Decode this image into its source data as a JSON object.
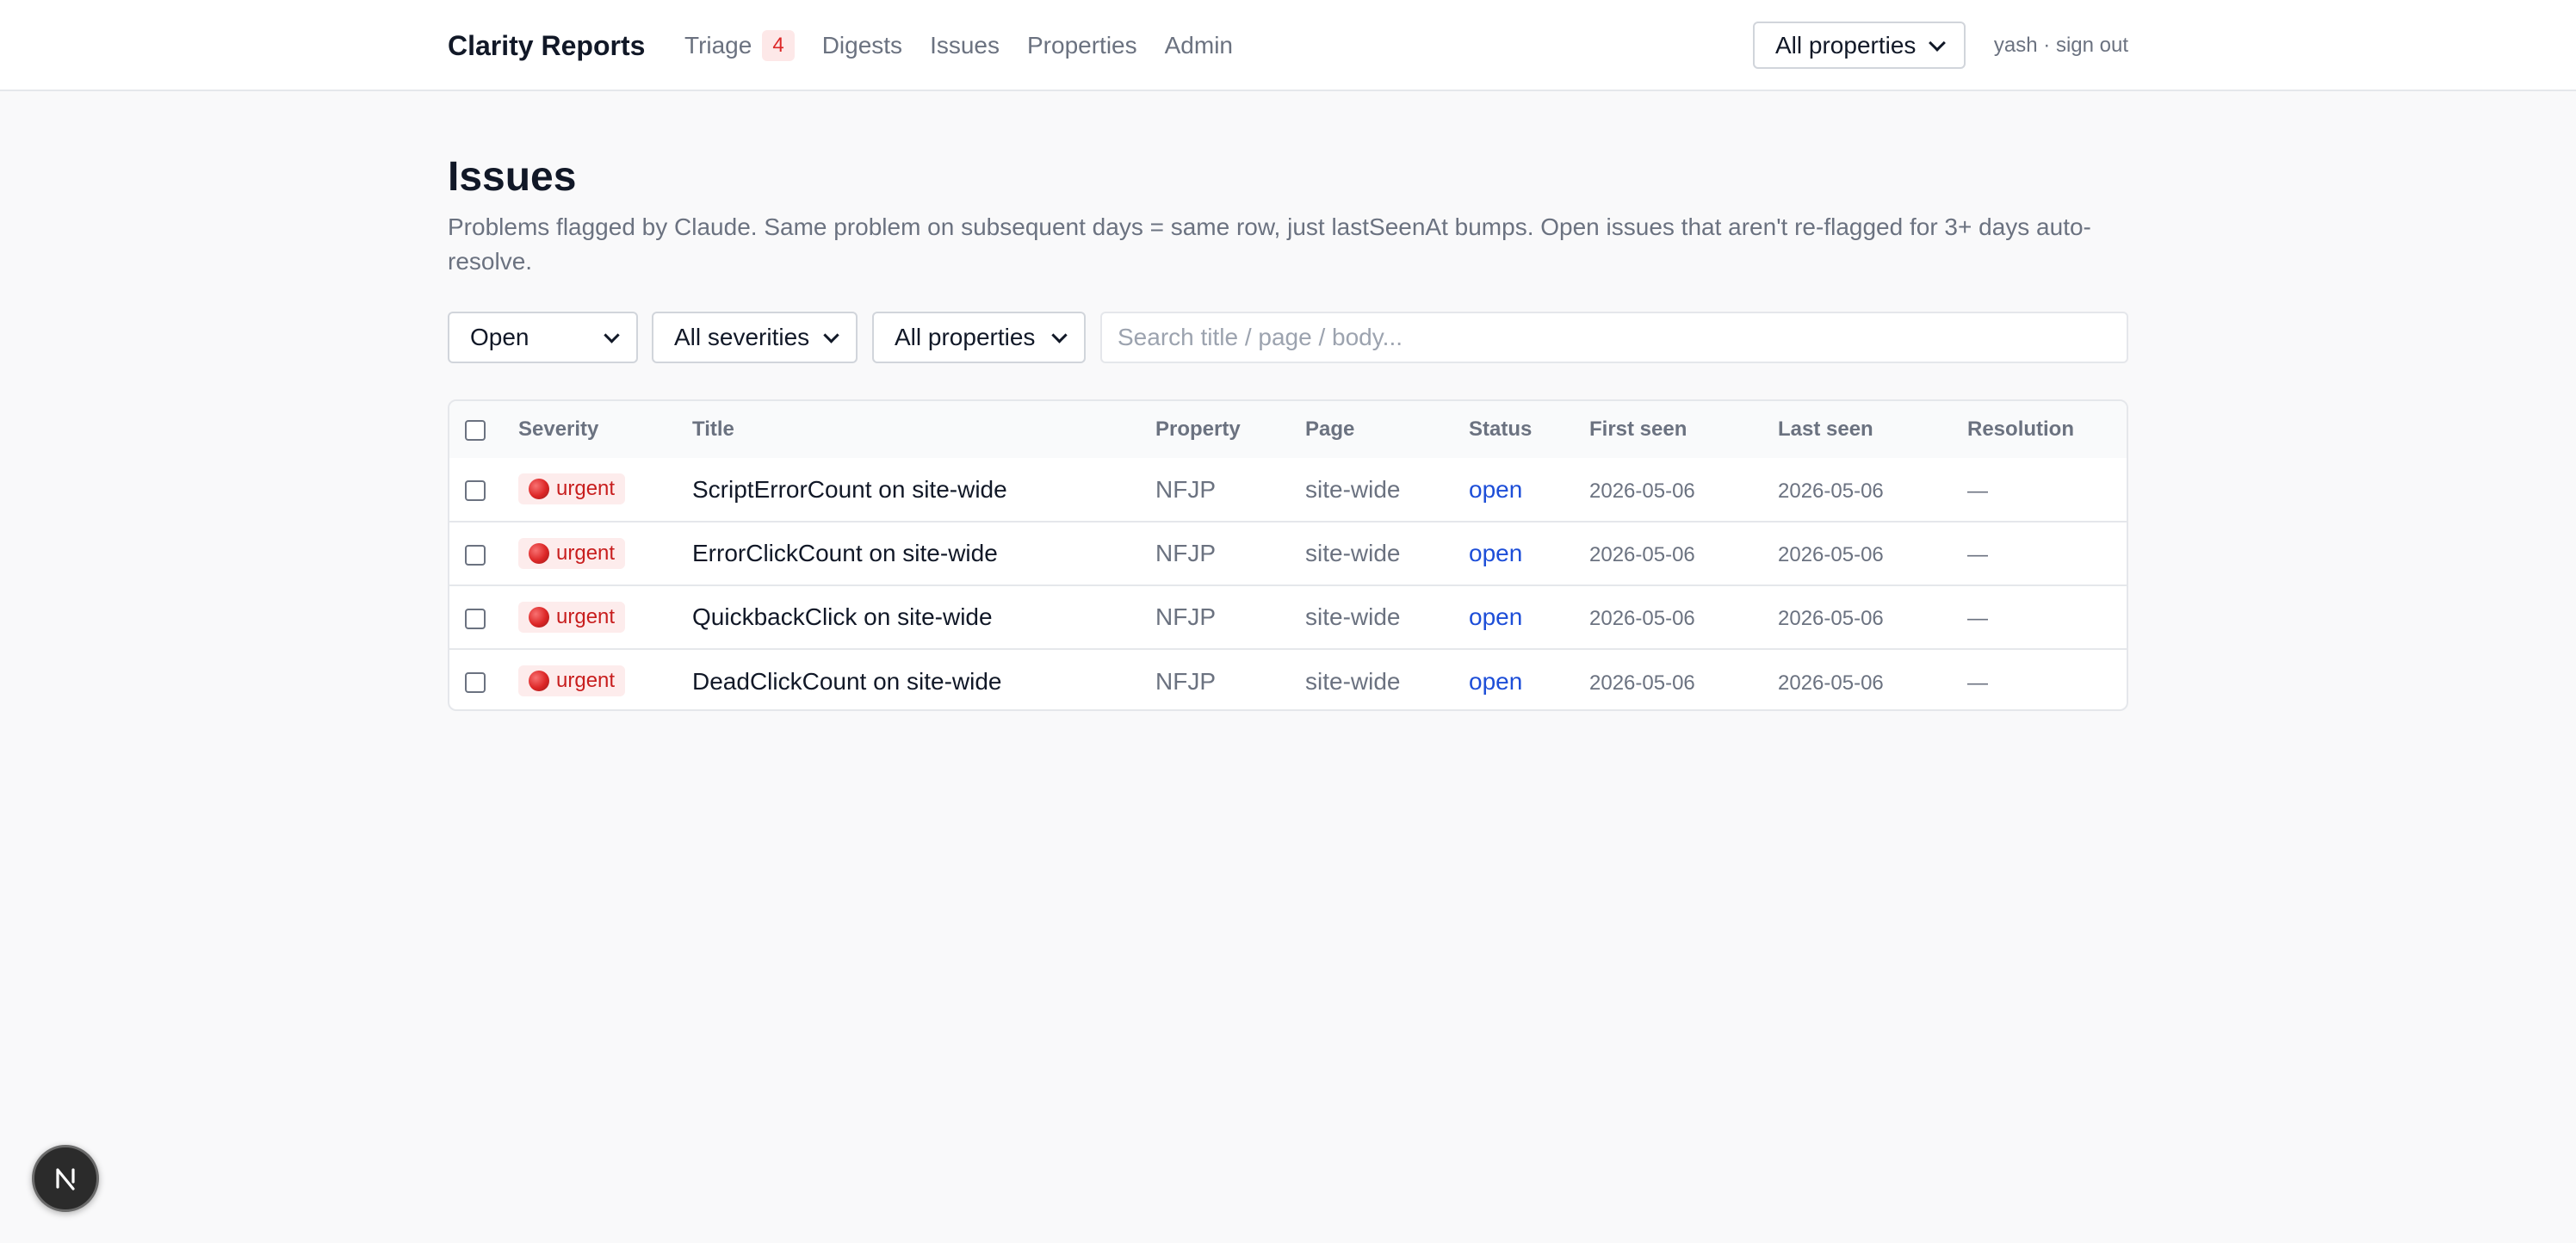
{
  "app": {
    "brand": "Clarity Reports"
  },
  "nav": {
    "items": [
      {
        "label": "Triage",
        "badge": "4"
      },
      {
        "label": "Digests"
      },
      {
        "label": "Issues"
      },
      {
        "label": "Properties"
      },
      {
        "label": "Admin"
      }
    ]
  },
  "header": {
    "property_select": "All properties",
    "user": "yash",
    "separator": "·",
    "sign_out": "sign out"
  },
  "page": {
    "title": "Issues",
    "description": "Problems flagged by Claude. Same problem on subsequent days = same row, just lastSeenAt bumps. Open issues that aren't re-flagged for 3+ days auto-resolve."
  },
  "filters": {
    "status": "Open",
    "severity": "All severities",
    "property": "All properties",
    "search_placeholder": "Search title / page / body..."
  },
  "table": {
    "columns": [
      "Severity",
      "Title",
      "Property",
      "Page",
      "Status",
      "First seen",
      "Last seen",
      "Resolution"
    ],
    "rows": [
      {
        "severity": "urgent",
        "title": "ScriptErrorCount on site-wide",
        "property": "NFJP",
        "page": "site-wide",
        "status": "open",
        "first_seen": "2026-05-06",
        "last_seen": "2026-05-06",
        "resolution": "—"
      },
      {
        "severity": "urgent",
        "title": "ErrorClickCount on site-wide",
        "property": "NFJP",
        "page": "site-wide",
        "status": "open",
        "first_seen": "2026-05-06",
        "last_seen": "2026-05-06",
        "resolution": "—"
      },
      {
        "severity": "urgent",
        "title": "QuickbackClick on site-wide",
        "property": "NFJP",
        "page": "site-wide",
        "status": "open",
        "first_seen": "2026-05-06",
        "last_seen": "2026-05-06",
        "resolution": "—"
      },
      {
        "severity": "urgent",
        "title": "DeadClickCount on site-wide",
        "property": "NFJP",
        "page": "site-wide",
        "status": "open",
        "first_seen": "2026-05-06",
        "last_seen": "2026-05-06",
        "resolution": "—"
      }
    ]
  },
  "dev_tools": {
    "icon": "nextjs-n-icon"
  },
  "colors": {
    "background": "#f9f9fa",
    "accent_link": "#1d4ed8",
    "urgent_text": "#c81e1e",
    "urgent_bg": "#fdecec",
    "badge_text": "#dc2626"
  }
}
